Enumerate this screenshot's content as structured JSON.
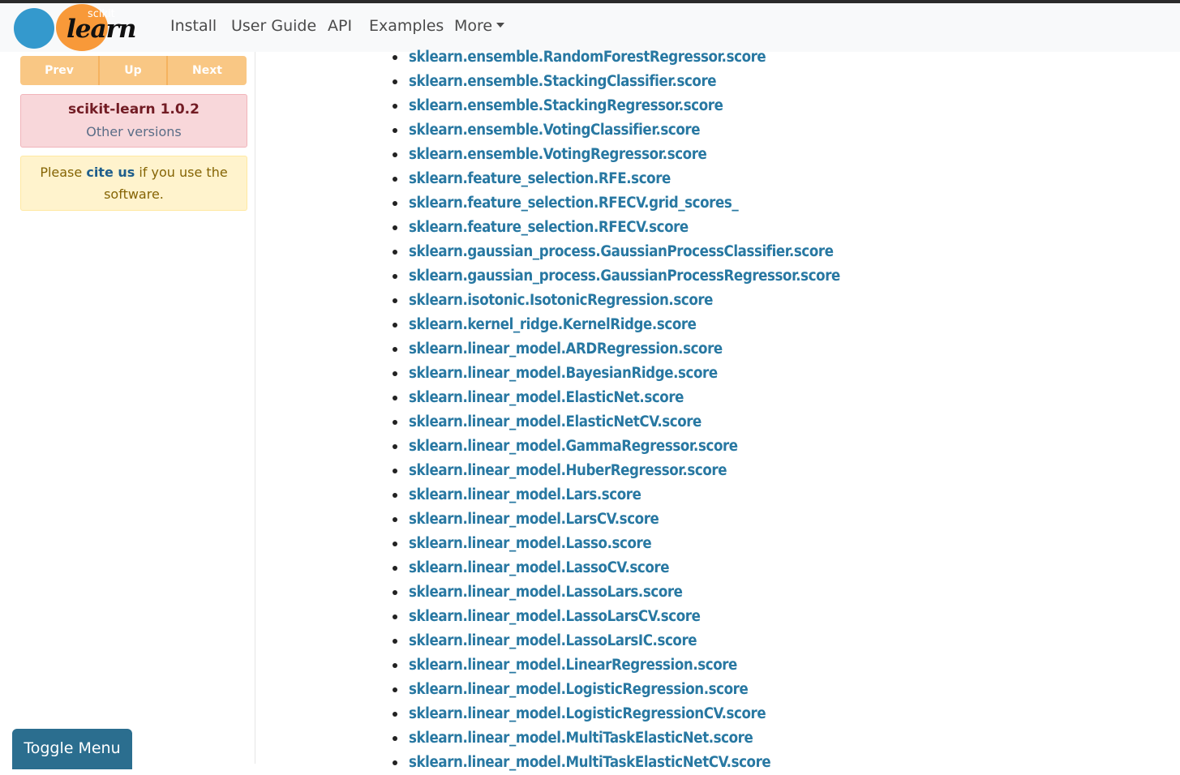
{
  "navbar": {
    "logo_text": "scikit learn",
    "links": [
      "Install",
      "User Guide",
      "API",
      "Examples",
      "More"
    ]
  },
  "sidebar": {
    "rel_nav": {
      "prev": "Prev",
      "up": "Up",
      "next": "Next"
    },
    "version": {
      "title": "scikit-learn 1.0.2",
      "link": "Other versions"
    },
    "cite": {
      "prefix": "Please ",
      "link": "cite us",
      "suffix": " if you use the software."
    },
    "toggle_menu": "Toggle Menu"
  },
  "references": [
    "sklearn.ensemble.RandomForestRegressor.score",
    "sklearn.ensemble.StackingClassifier.score",
    "sklearn.ensemble.StackingRegressor.score",
    "sklearn.ensemble.VotingClassifier.score",
    "sklearn.ensemble.VotingRegressor.score",
    "sklearn.feature_selection.RFE.score",
    "sklearn.feature_selection.RFECV.grid_scores_",
    "sklearn.feature_selection.RFECV.score",
    "sklearn.gaussian_process.GaussianProcessClassifier.score",
    "sklearn.gaussian_process.GaussianProcessRegressor.score",
    "sklearn.isotonic.IsotonicRegression.score",
    "sklearn.kernel_ridge.KernelRidge.score",
    "sklearn.linear_model.ARDRegression.score",
    "sklearn.linear_model.BayesianRidge.score",
    "sklearn.linear_model.ElasticNet.score",
    "sklearn.linear_model.ElasticNetCV.score",
    "sklearn.linear_model.GammaRegressor.score",
    "sklearn.linear_model.HuberRegressor.score",
    "sklearn.linear_model.Lars.score",
    "sklearn.linear_model.LarsCV.score",
    "sklearn.linear_model.Lasso.score",
    "sklearn.linear_model.LassoCV.score",
    "sklearn.linear_model.LassoLars.score",
    "sklearn.linear_model.LassoLarsCV.score",
    "sklearn.linear_model.LassoLarsIC.score",
    "sklearn.linear_model.LinearRegression.score",
    "sklearn.linear_model.LogisticRegression.score",
    "sklearn.linear_model.LogisticRegressionCV.score",
    "sklearn.linear_model.MultiTaskElasticNet.score",
    "sklearn.linear_model.MultiTaskElasticNetCV.score"
  ],
  "colors": {
    "link": "#2878a2",
    "logo_blue": "#3499cd",
    "logo_orange": "#f89939"
  }
}
